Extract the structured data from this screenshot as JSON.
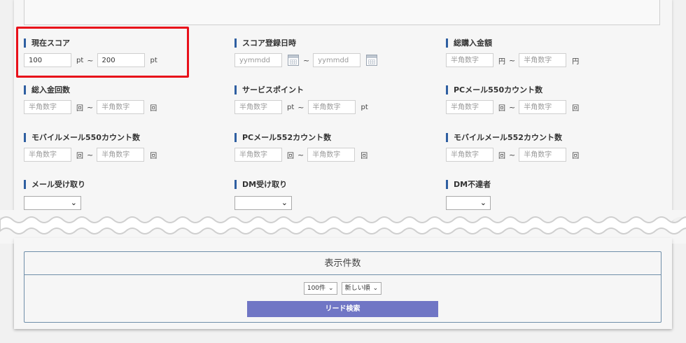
{
  "colors": {
    "highlight": "#e8101a",
    "label_bar": "#2f5fa1",
    "search_button": "#7076c5",
    "box_border": "#6f8ea9"
  },
  "fields": {
    "current_score": {
      "label": "現在スコア",
      "from_value": "100",
      "to_value": "200",
      "unit": "pt",
      "tilde": "~",
      "unit_end": "pt"
    },
    "score_registered_at": {
      "label": "スコア登録日時",
      "from_placeholder": "yymmdd",
      "to_placeholder": "yymmdd",
      "tilde": "~",
      "icon": "calendar-icon"
    },
    "total_deposit_amount": {
      "label": "総購入金額",
      "placeholder": "半角数字",
      "unit": "円",
      "tilde": "~",
      "unit_end": "円"
    },
    "total_deposit_count": {
      "label": "総入金回数",
      "placeholder": "半角数字",
      "unit": "回",
      "tilde": "~",
      "unit_end": "回"
    },
    "service_points": {
      "label": "サービスポイント",
      "placeholder": "半角数字",
      "unit": "pt",
      "tilde": "~",
      "unit_end": "pt"
    },
    "pc_mail_550": {
      "label": "PCメール550カウント数",
      "placeholder": "半角数字",
      "unit": "回",
      "tilde": "~",
      "unit_end": "回"
    },
    "mobile_mail_550": {
      "label": "モバイルメール550カウント数",
      "placeholder": "半角数字",
      "unit": "回",
      "tilde": "~",
      "unit_end": "回"
    },
    "pc_mail_552": {
      "label": "PCメール552カウント数",
      "placeholder": "半角数字",
      "unit": "回",
      "tilde": "~",
      "unit_end": "回"
    },
    "mobile_mail_552": {
      "label": "モバイルメール552カウント数",
      "placeholder": "半角数字",
      "unit": "回",
      "tilde": "~",
      "unit_end": "回"
    },
    "mail_receive": {
      "label": "メール受け取り",
      "value": ""
    },
    "dm_receive": {
      "label": "DM受け取り",
      "value": ""
    },
    "dm_undelivered": {
      "label": "DM不達者",
      "value": ""
    }
  },
  "display": {
    "title": "表示件数",
    "count_option": "100件",
    "sort_option": "新しい順",
    "search_label": "リード検索"
  }
}
